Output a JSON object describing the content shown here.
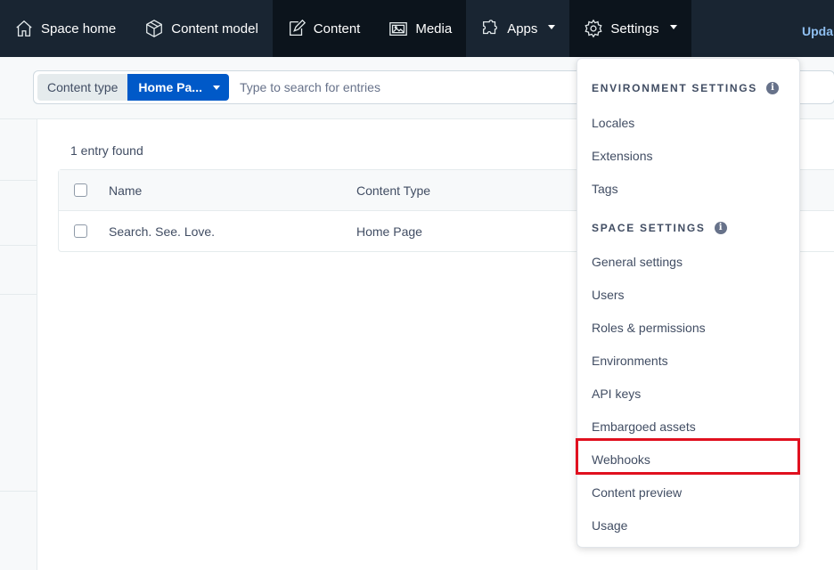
{
  "nav": {
    "space_home": "Space home",
    "content_model": "Content model",
    "content": "Content",
    "media": "Media",
    "apps": "Apps",
    "settings": "Settings"
  },
  "search": {
    "content_type_label": "Content type",
    "content_type_value": "Home Pa...",
    "placeholder": "Type to search for entries",
    "update_link": "Upda"
  },
  "main": {
    "count": "1 entry found",
    "columns": {
      "name": "Name",
      "content_type": "Content Type"
    },
    "rows": [
      {
        "name": "Search. See. Love.",
        "content_type": "Home Page"
      }
    ]
  },
  "dropdown": {
    "env_heading": "ENVIRONMENT SETTINGS",
    "env_items": [
      "Locales",
      "Extensions",
      "Tags"
    ],
    "space_heading": "SPACE SETTINGS",
    "space_items": [
      "General settings",
      "Users",
      "Roles & permissions",
      "Environments",
      "API keys",
      "Embargoed assets",
      "Webhooks",
      "Content preview",
      "Usage"
    ]
  },
  "colors": {
    "nav_bg": "#192532",
    "accent": "#0059c8",
    "highlight": "#e0101f"
  }
}
